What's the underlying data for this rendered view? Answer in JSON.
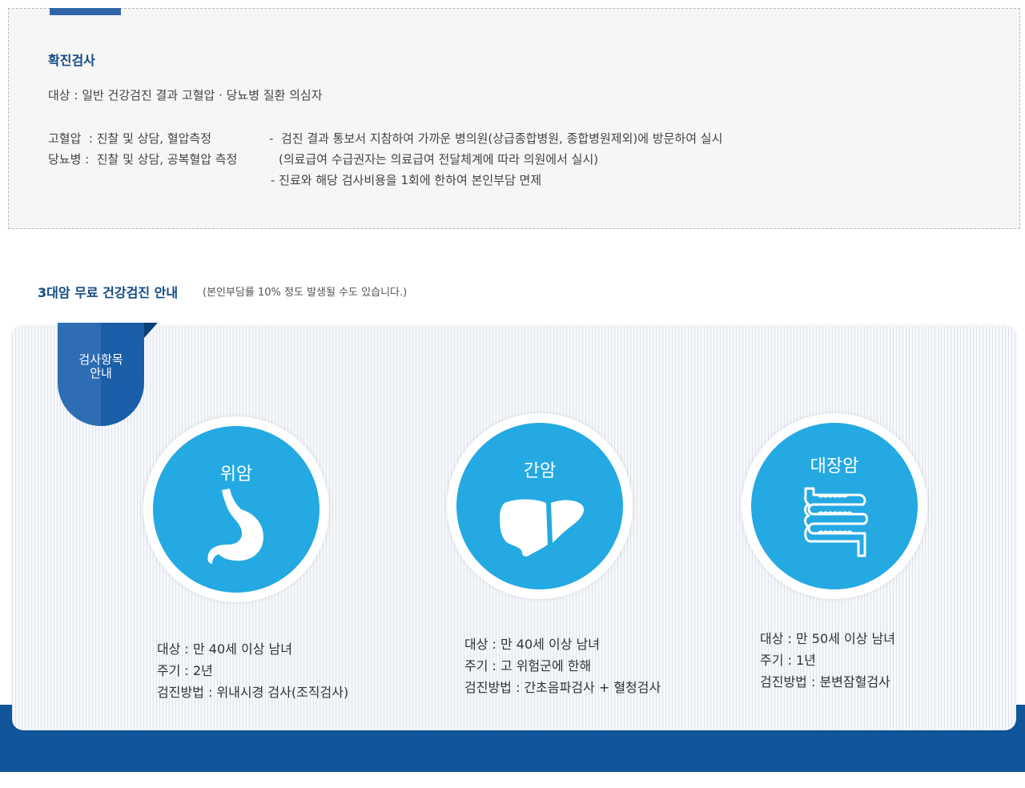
{
  "confirm": {
    "title": "확진검사",
    "target": "대상 : 일반 건강검진 결과 고혈압 · 당뇨병 질환 의심자",
    "bp_label": "고혈압  : 진찰 및 상담, 혈압측정",
    "dm_label": "당뇨병 :  진찰 및 상담, 공복혈압 측정",
    "note1": "-  검진 결과 통보서 지참하여 가까운 병의원(상급종합병원, 종합병원제외)에 방문하여 실시",
    "note2": "(의료급여 수급권자는 의료급여 전달체계에 따라 의원에서 실시)",
    "note3": "- 진료와 해당 검사비용을 1회에 한하여 본인부담 면제"
  },
  "cancer": {
    "title": "3대암 무료 건강검진 안내",
    "note": "(본인부담률 10% 정도 발생될 수도 있습니다.)",
    "ribbon_line1": "검사항목",
    "ribbon_line2": "안내",
    "items": [
      {
        "name": "위암",
        "icon": "stomach-icon",
        "target": "대상 :  만 40세 이상 남녀",
        "cycle": "주기 : 2년",
        "method": "검진방법 : 위내시경 검사(조직검사)"
      },
      {
        "name": "간암",
        "icon": "liver-icon",
        "target": "대상 :  만 40세 이상 남녀",
        "cycle": "주기 : 고 위험군에 한해",
        "method": "검진방법 : 간초음파검사 + 혈청검사"
      },
      {
        "name": "대장암",
        "icon": "colon-icon",
        "target": "대상 :  만 50세 이상 남녀",
        "cycle": "주기 : 1년",
        "method": "검진방법 : 분변잠혈검사"
      }
    ]
  },
  "colors": {
    "accent": "#114a86",
    "circle": "#24a9e2",
    "band": "#11569a"
  }
}
